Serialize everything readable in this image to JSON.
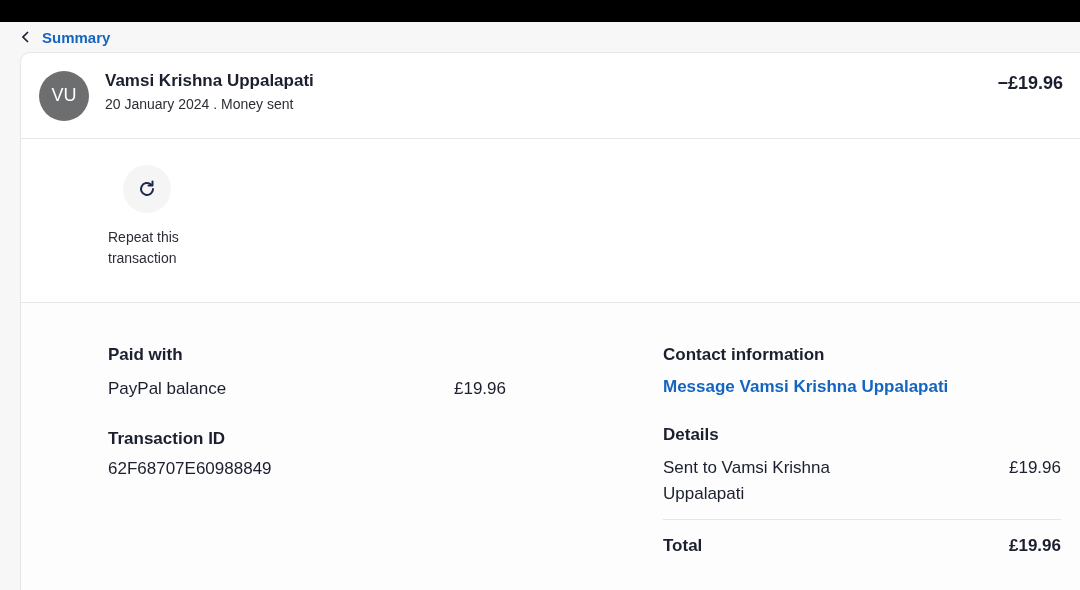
{
  "back_link": {
    "label": "Summary"
  },
  "header": {
    "initials": "VU",
    "name": "Vamsi Krishna Uppalapati",
    "subtitle": "20 January 2024 . Money sent",
    "amount": "−£19.96"
  },
  "actions": [
    {
      "label": "Repeat this transaction"
    }
  ],
  "paid_with": {
    "heading": "Paid with",
    "method": "PayPal balance",
    "amount": "£19.96"
  },
  "transaction_id": {
    "heading": "Transaction ID",
    "value": "62F68707E60988849"
  },
  "contact": {
    "heading": "Contact information",
    "link": "Message Vamsi Krishna Uppalapati"
  },
  "details": {
    "heading": "Details",
    "rows": [
      {
        "label": "Sent to Vamsi Krishna Uppalapati",
        "amount": "£19.96"
      }
    ],
    "total_label": "Total",
    "total_amount": "£19.96"
  }
}
